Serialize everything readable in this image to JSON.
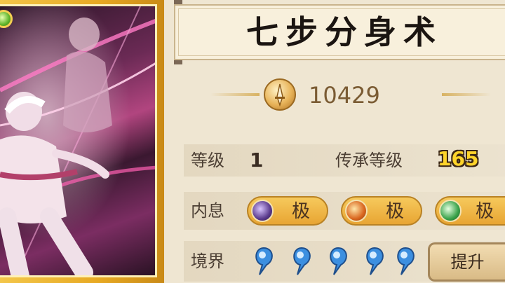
{
  "skill": {
    "name": "七步分身术",
    "power": "10429"
  },
  "stats": {
    "level_label": "等级",
    "level_value": "1",
    "inherit_label": "传承等级",
    "inherit_value": "165"
  },
  "inner": {
    "label": "内息",
    "slots": [
      {
        "text": "极",
        "orb_color": "#5a3a8c",
        "icon": "crescent-moon-icon"
      },
      {
        "text": "极",
        "orb_color": "#d9661e",
        "icon": "sun-icon"
      },
      {
        "text": "极",
        "orb_color": "#3aa24a",
        "icon": "green-ring-icon"
      }
    ]
  },
  "realm": {
    "label": "境界",
    "drop_count": 5,
    "drop_color": "#3c8fe0",
    "upgrade_label": "提升"
  },
  "colors": {
    "panel_bg": "#efe6d2",
    "card_frame": "#e7a923",
    "accent_gold": "#ffd42a"
  }
}
